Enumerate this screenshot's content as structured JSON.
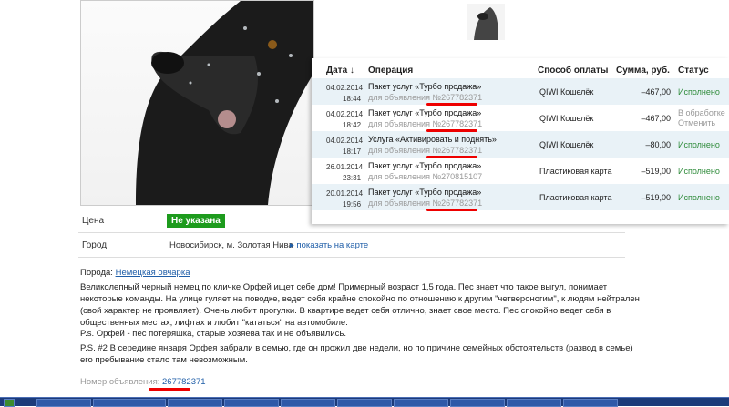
{
  "table": {
    "headers": {
      "date": "Дата ↓",
      "operation": "Операция",
      "payment": "Способ оплаты",
      "sum": "Сумма, руб.",
      "status": "Статус"
    },
    "rows": [
      {
        "date": "04.02.2014",
        "time": "18:44",
        "operation": "Пакет услуг «Турбо продажа»",
        "sub": "для объявления №267782371",
        "payment": "QIWI Кошелёк",
        "sum": "–467,00",
        "status": "Исполнено",
        "status2": ""
      },
      {
        "date": "04.02.2014",
        "time": "18:42",
        "operation": "Пакет услуг «Турбо продажа»",
        "sub": "для объявления №267782371",
        "payment": "QIWI Кошелёк",
        "sum": "–467,00",
        "status": "В обработке",
        "status2": "Отменить"
      },
      {
        "date": "04.02.2014",
        "time": "18:17",
        "operation": "Услуга «Активировать и поднять»",
        "sub": "для объявления №267782371",
        "payment": "QIWI Кошелёк",
        "sum": "–80,00",
        "status": "Исполнено",
        "status2": ""
      },
      {
        "date": "26.01.2014",
        "time": "23:31",
        "operation": "Пакет услуг «Турбо продажа»",
        "sub": "для объявления №270815107",
        "payment": "Пластиковая карта",
        "sum": "–519,00",
        "status": "Исполнено",
        "status2": ""
      },
      {
        "date": "20.01.2014",
        "time": "19:56",
        "operation": "Пакет услуг «Турбо продажа»",
        "sub": "для объявления №267782371",
        "payment": "Пластиковая карта",
        "sum": "–519,00",
        "status": "Исполнено",
        "status2": ""
      }
    ]
  },
  "listing": {
    "price_label": "Цена",
    "price_value": "Не указана",
    "city_label": "Город",
    "city_value": "Новосибирск, м. Золотая Нива",
    "map_link": "показать на карте",
    "breed_label": "Порода:",
    "breed_value": "Немецкая овчарка",
    "p1": "Великолепный черный немец по кличке Орфей ищет себе дом! Примерный возраст 1,5 года. Пес знает что такое выгул, понимает некоторые команды. На улице гуляет на поводке, ведет себя крайне спокойно по отношению к другим \"четвероногим\", к людям нейтрален (свой характер не проявляет). Очень любит прогулки. В квартире ведет себя отлично, знает свое место. Пес спокойно ведет себя в общественных местах, лифтах и любит \"кататься\" на автомобиле.",
    "p2": "P.s. Орфей - пес потеряшка, старые хозяева так и не объявились.",
    "p3": "P.S. #2 В середине января Орфея забрали в семью, где он прожил две недели, но по причине семейных обстоятельств (развод в семье) его пребывание стало там невозможным.",
    "ad_number_label": "Номер объявления:",
    "ad_number": "267782371"
  }
}
